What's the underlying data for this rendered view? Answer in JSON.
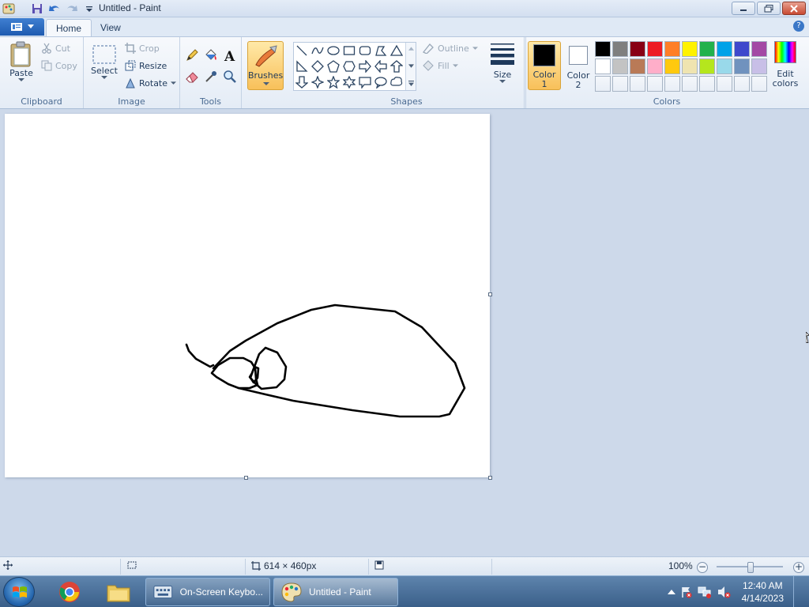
{
  "window": {
    "title": "Untitled - Paint"
  },
  "tabs": [
    {
      "label": "Home"
    },
    {
      "label": "View"
    }
  ],
  "ribbon": {
    "clipboard": {
      "label": "Clipboard",
      "paste": "Paste",
      "cut": "Cut",
      "copy": "Copy"
    },
    "image": {
      "label": "Image",
      "select": "Select",
      "crop": "Crop",
      "resize": "Resize",
      "rotate": "Rotate"
    },
    "tools": {
      "label": "Tools"
    },
    "brushes": {
      "label": "Brushes"
    },
    "shapes": {
      "label": "Shapes",
      "outline": "Outline",
      "fill": "Fill"
    },
    "size": {
      "label": "Size"
    },
    "color1": {
      "label": "Color",
      "num": "1",
      "value": "#000000"
    },
    "color2": {
      "label": "Color",
      "num": "2",
      "value": "#ffffff"
    },
    "colors": {
      "label": "Colors",
      "edit": "Edit",
      "edit2": "colors",
      "palette": [
        "#000000",
        "#7f7f7f",
        "#880015",
        "#ed1c24",
        "#ff7f27",
        "#fff200",
        "#22b14c",
        "#00a2e8",
        "#3f48cc",
        "#a349a4",
        "#ffffff",
        "#c3c3c3",
        "#b97a57",
        "#ffaec9",
        "#ffc90e",
        "#efe4b0",
        "#b5e61d",
        "#99d9ea",
        "#7092be",
        "#c8bfe7",
        "#ffffff",
        "#ffffff",
        "#ffffff",
        "#ffffff",
        "#ffffff",
        "#ffffff",
        "#ffffff",
        "#ffffff",
        "#ffffff",
        "#ffffff"
      ]
    }
  },
  "status": {
    "canvas_size": "614 × 460px",
    "zoom": "100%"
  },
  "taskbar": {
    "tasks": [
      {
        "label": "On-Screen Keybo..."
      },
      {
        "label": "Untitled - Paint"
      }
    ],
    "clock": {
      "time": "12:40 AM",
      "date": "4/14/2023"
    }
  }
}
